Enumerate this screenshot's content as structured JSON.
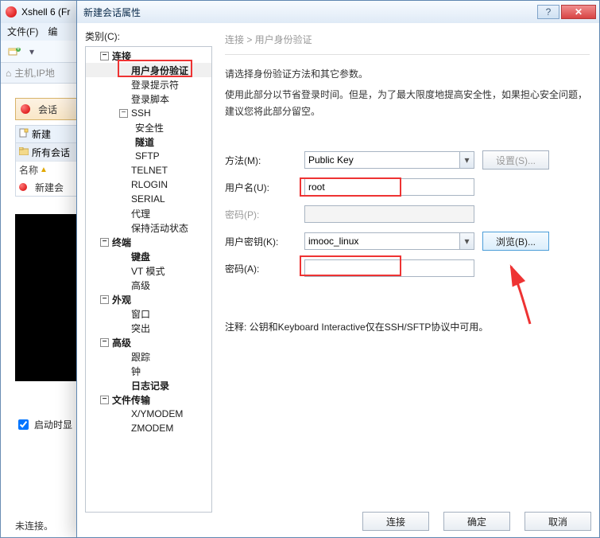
{
  "bg": {
    "title": "Xshell 6 (Fr",
    "menu_file": "文件(F)",
    "menu_edit_prefix": "编",
    "addr_label": "主机,IP地",
    "session_tab": "会话",
    "new_btn": "新建",
    "all_sessions": "所有会话",
    "name_col": "名称",
    "new_session": "新建会",
    "status": "未连接。",
    "startup_chk": "启动时显"
  },
  "dlg": {
    "title": "新建会话属性",
    "category_label": "类别(C):",
    "breadcrumb": "连接  >  用户身份验证",
    "desc_line1": "请选择身份验证方法和其它参数。",
    "desc_line2": "使用此部分以节省登录时间。但是，为了最大限度地提高安全性，如果担心安全问题，建议您将此部分留空。",
    "labels": {
      "method": "方法(M):",
      "username": "用户名(U):",
      "password": "密码(P):",
      "userkey": "用户密钥(K):",
      "passphrase": "密码(A):"
    },
    "values": {
      "method": "Public Key",
      "username": "root",
      "password": "",
      "userkey": "imooc_linux",
      "passphrase": ""
    },
    "settings_btn": "设置(S)...",
    "browse_btn": "浏览(B)...",
    "note": "注释: 公钥和Keyboard Interactive仅在SSH/SFTP协议中可用。",
    "footer": {
      "connect": "连接",
      "ok": "确定",
      "cancel": "取消"
    }
  },
  "tree": {
    "conn": "连接",
    "auth": "用户身份验证",
    "login_prompt": "登录提示符",
    "login_script": "登录脚本",
    "ssh": "SSH",
    "security": "安全性",
    "tunnel": "隧道",
    "sftp": "SFTP",
    "telnet": "TELNET",
    "rlogin": "RLOGIN",
    "serial": "SERIAL",
    "proxy": "代理",
    "keepalive": "保持活动状态",
    "terminal": "终端",
    "keyboard": "键盘",
    "vtmode": "VT 模式",
    "advanced_t": "高级",
    "appearance": "外观",
    "window": "窗口",
    "highlight": "突出",
    "advanced": "高级",
    "trace": "跟踪",
    "bell": "钟",
    "logging": "日志记录",
    "filetransfer": "文件传输",
    "xymodem": "X/YMODEM",
    "zmodem": "ZMODEM"
  }
}
